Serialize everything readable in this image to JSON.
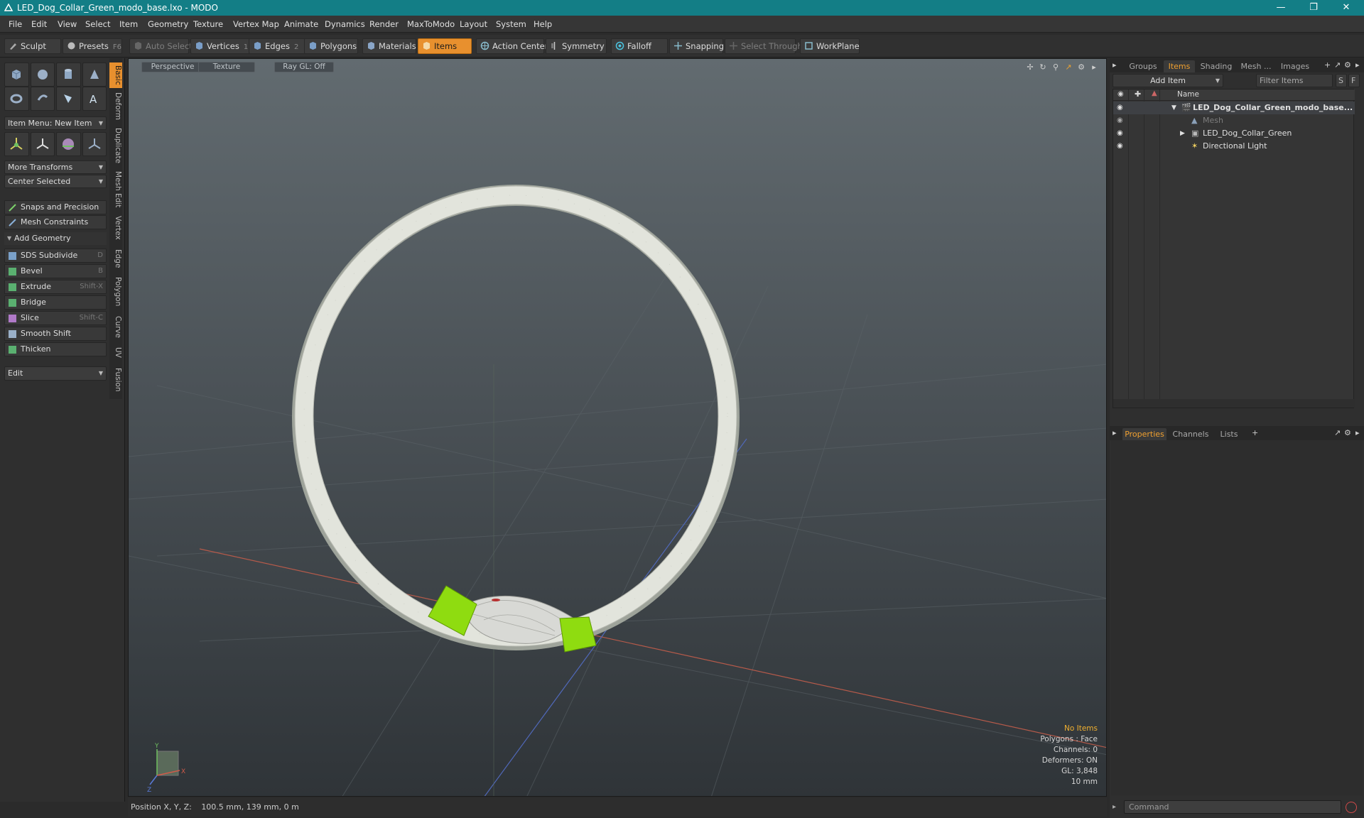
{
  "window": {
    "title": "LED_Dog_Collar_Green_modo_base.lxo - MODO"
  },
  "menu": [
    "File",
    "Edit",
    "View",
    "Select",
    "Item",
    "Geometry",
    "Texture",
    "Vertex Map",
    "Animate",
    "Dynamics",
    "Render",
    "MaxToModo",
    "Layout",
    "System",
    "Help"
  ],
  "toolbar": {
    "sculpt": "Sculpt",
    "presets": "Presets",
    "presets_key": "F6",
    "auto_select": "Auto Select",
    "vertices": "Vertices",
    "vertices_key": "1",
    "edges": "Edges",
    "edges_key": "2",
    "polygons": "Polygons",
    "materials": "Materials",
    "items": "Items",
    "action_center": "Action Center",
    "symmetry": "Symmetry",
    "falloff": "Falloff",
    "snapping": "Snapping",
    "select_through": "Select Through",
    "workplane": "WorkPlane"
  },
  "left_panel": {
    "item_menu": "Item Menu: New Item",
    "more_transforms": "More Transforms",
    "center_selected": "Center Selected",
    "snaps": "Snaps and Precision",
    "mesh_constraints": "Mesh Constraints",
    "add_geometry": "Add Geometry",
    "tools": [
      {
        "label": "SDS Subdivide",
        "key": "D"
      },
      {
        "label": "Bevel",
        "key": "B"
      },
      {
        "label": "Extrude",
        "key": "Shift-X"
      },
      {
        "label": "Bridge",
        "key": ""
      },
      {
        "label": "Slice",
        "key": "Shift-C"
      },
      {
        "label": "Smooth Shift",
        "key": ""
      },
      {
        "label": "Thicken",
        "key": ""
      }
    ],
    "edit_dropdown": "Edit",
    "vertical_tabs": [
      "Basic",
      "Deform",
      "Duplicate",
      "Mesh Edit",
      "Vertex",
      "Edge",
      "Polygon",
      "Curve",
      "UV",
      "Fusion"
    ]
  },
  "viewport": {
    "view_mode": "Perspective",
    "shading": "Texture",
    "raygl": "Ray GL: Off",
    "info": {
      "selection": "No Items",
      "polygons": "Polygons : Face",
      "channels": "Channels: 0",
      "deformers": "Deformers: ON",
      "gl": "GL: 3,848",
      "scale": "10 mm"
    },
    "axis_y": "Y",
    "axis_x": "X",
    "axis_z": "Z"
  },
  "status": {
    "position_label": "Position X, Y, Z:",
    "position_value": "100.5 mm, 139 mm, 0 m"
  },
  "right_panel": {
    "top_tabs": [
      "Groups",
      "Items",
      "Shading",
      "Mesh ...",
      "Images"
    ],
    "add_item": "Add Item",
    "filter_items": "Filter Items",
    "filter_s": "S",
    "filter_f": "F",
    "name_header": "Name",
    "scene_items": [
      {
        "label": "LED_Dog_Collar_Green_modo_base...",
        "bold": true
      },
      {
        "label": "Mesh",
        "bold": false
      },
      {
        "label": "LED_Dog_Collar_Green",
        "bold": false
      },
      {
        "label": "Directional Light",
        "bold": false
      }
    ],
    "bottom_tabs": [
      "Properties",
      "Channels",
      "Lists"
    ],
    "command_placeholder": "Command"
  },
  "colors": {
    "accent": "#e8902e",
    "titlebar": "#137e86",
    "collar_strap": "#e2e4dc",
    "collar_light": "#8fdc10"
  }
}
